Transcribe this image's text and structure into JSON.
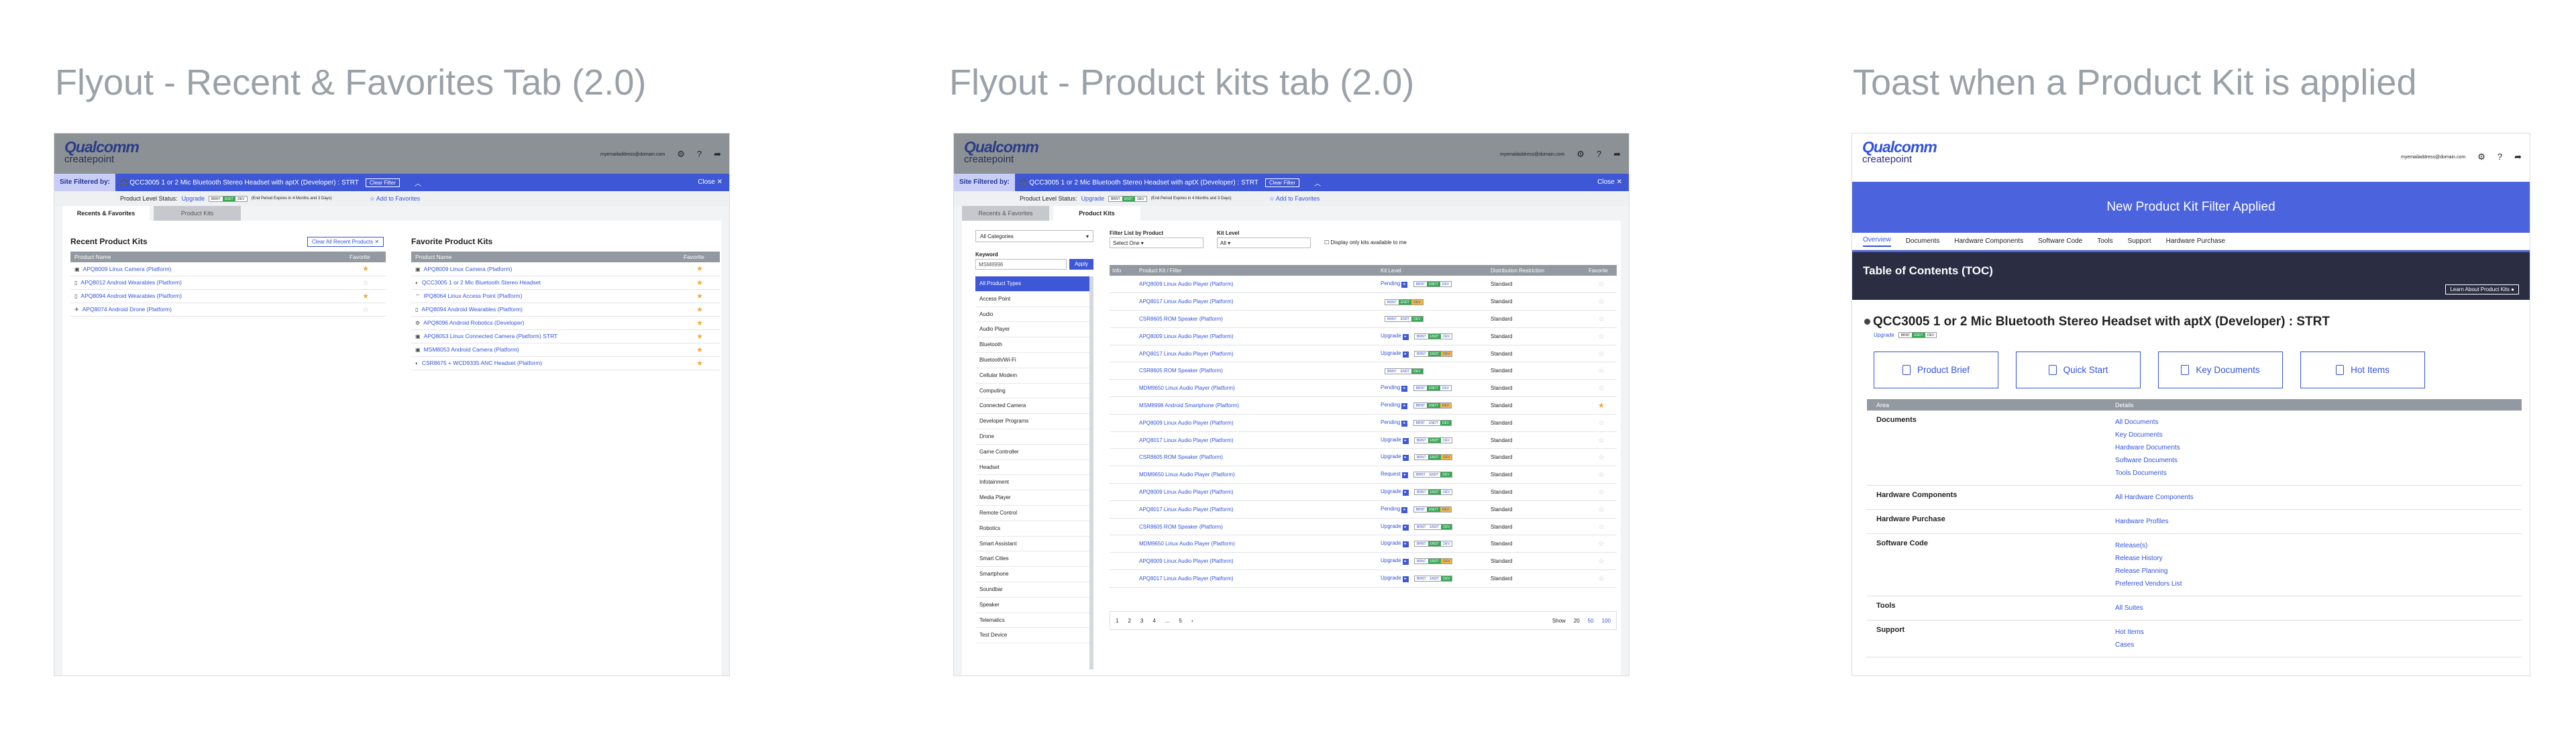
{
  "titles": [
    "Flyout - Recent & Favorites Tab (2.0)",
    "Flyout - Product kits tab (2.0)",
    "Toast when a Product Kit is applied"
  ],
  "header": {
    "logo": "Qualcomm",
    "sub": "createpoint",
    "email": "myemailaddress@domain.com"
  },
  "filter": {
    "label": "Site Filtered by:",
    "product": "QCC3005 1 or 2 Mic Bluetooth Stereo Headset with aptX (Developer) : STRT",
    "clear": "Clear Filter",
    "close": "Close"
  },
  "status": {
    "label": "Product Level Status:",
    "link": "Upgrade",
    "note": "(End Period Expires in 4 Months and 3 Days)",
    "fav": "Add to Favorites",
    "pills": [
      "BRNT",
      "ENDT",
      "DEV"
    ]
  },
  "tabs": [
    "Recents & Favorites",
    "Product Kits"
  ],
  "recent": {
    "title": "Recent Product Kits",
    "clear": "Clear All Recent Products",
    "cols": [
      "Product Name",
      "Favorite"
    ],
    "rows": [
      {
        "name": "APQ8009 Linux Camera (Platform)",
        "fav": true
      },
      {
        "name": "APQ8012 Android Wearables (Platform)",
        "fav": false
      },
      {
        "name": "APQ8094 Android Wearables (Platform)",
        "fav": true
      },
      {
        "name": "APQ8074 Android Drone (Platform)",
        "fav": false
      }
    ]
  },
  "favorite": {
    "title": "Favorite Product Kits",
    "cols": [
      "Product Name",
      "Favorite"
    ],
    "rows": [
      "APQ8009 Linux Camera (Platform)",
      "QCC3005 1 or 2 Mic Bluetooth Stereo Headset",
      "IPQ8064 Linux Access Point (Platform)",
      "APQ8094 Android Wearables (Platform)",
      "APQ8096 Android Robotics (Developer)",
      "APQ8053 Linux Connected Camera (Platform) STRT",
      "MSM8053 Android Camera (Platform)",
      "CSR8675 + WCD9335 ANC Headset (Platform)"
    ]
  },
  "kits": {
    "cat": "All Categories",
    "kwl": "Keyword",
    "kw": "MSM8996",
    "apply": "Apply",
    "types": [
      "All Product Types",
      "Access Point",
      "Audio",
      "Audio Player",
      "Bluetooth",
      "Bluetooth/Wi-Fi",
      "Cellular Modem",
      "Computing",
      "Connected Camera",
      "Developer Programs",
      "Drone",
      "Game Controller",
      "Headset",
      "Infotainment",
      "Media Player",
      "Remote Control",
      "Robotics",
      "Smart Assistant",
      "Smart Cities",
      "Smartphone",
      "Soundbar",
      "Speaker",
      "Telematics",
      "Test Device"
    ],
    "f1": "Filter List by Product",
    "f1v": "Select One",
    "f2": "Kit Level",
    "f2v": "All",
    "chk": "Display only kits available to me",
    "cols": [
      "Info",
      "Product Kit / Filter",
      "Kit Level",
      "Distribution Restriction",
      "Favorite"
    ],
    "rows": [
      {
        "n": "APQ8009 Linux Audio Player (Platform)",
        "k": "Pending",
        "d": "Standard"
      },
      {
        "n": "APQ8017 Linux Audio Player (Platform)",
        "k": "",
        "d": "Standard"
      },
      {
        "n": "CSR8605 ROM Speaker (Platform)",
        "k": "",
        "d": "Standard"
      },
      {
        "n": "APQ8009 Linux Audio Player (Platform)",
        "k": "Upgrade",
        "d": "Standard"
      },
      {
        "n": "APQ8017 Linux Audio Player (Platform)",
        "k": "Upgrade",
        "d": "Standard"
      },
      {
        "n": "CSR8605 ROM Speaker (Platform)",
        "k": "",
        "d": "Standard"
      },
      {
        "n": "MDM9650 Linux Audio Player (Platform)",
        "k": "Pending",
        "d": "Standard"
      },
      {
        "n": "MSM8998 Android Smartphone (Platform)",
        "k": "Pending",
        "d": "Standard"
      },
      {
        "n": "APQ8009 Linux Audio Player (Platform)",
        "k": "Pending",
        "d": "Standard"
      },
      {
        "n": "APQ8017 Linux Audio Player (Platform)",
        "k": "Upgrade",
        "d": "Standard"
      },
      {
        "n": "CSR8605 ROM Speaker (Platform)",
        "k": "Upgrade",
        "d": "Standard"
      },
      {
        "n": "MDM9650 Linux Audio Player (Platform)",
        "k": "Request",
        "d": "Standard"
      },
      {
        "n": "APQ8009 Linux Audio Player (Platform)",
        "k": "Upgrade",
        "d": "Standard"
      },
      {
        "n": "APQ8017 Linux Audio Player (Platform)",
        "k": "Pending",
        "d": "Standard"
      },
      {
        "n": "CSR8605 ROM Speaker (Platform)",
        "k": "Upgrade",
        "d": "Standard"
      },
      {
        "n": "MDM9650 Linux Audio Player (Platform)",
        "k": "Upgrade",
        "d": "Standard"
      },
      {
        "n": "APQ8009 Linux Audio Player (Platform)",
        "k": "Upgrade",
        "d": "Standard"
      },
      {
        "n": "APQ8017 Linux Audio Player (Platform)",
        "k": "Upgrade",
        "d": "Standard"
      }
    ],
    "pages": [
      "1",
      "2",
      "3",
      "4",
      "...",
      "5"
    ],
    "show": "Show",
    "sizes": [
      "20",
      "50",
      "100"
    ]
  },
  "toast": {
    "msg": "New Product Kit Filter Applied",
    "nav": [
      "Overview",
      "Documents",
      "Hardware Components",
      "Software Code",
      "Tools",
      "Support",
      "Hardware Purchase"
    ],
    "toc": "Table of Contents (TOC)",
    "learn": "Learn About Product Kits",
    "pname": "QCC3005 1 or 2 Mic Bluetooth Stereo Headset with aptX (Developer) : STRT",
    "upg": "Upgrade",
    "cards": [
      "Product Brief",
      "Quick Start",
      "Key Documents",
      "Hot Items"
    ],
    "cols": [
      "Area",
      "Details"
    ],
    "areas": [
      {
        "k": "Documents",
        "v": [
          "All Documents",
          "Key Documents",
          "Hardware Documents",
          "Software Documents",
          "Tools Documents"
        ]
      },
      {
        "k": "Hardware Components",
        "v": [
          "All Hardware Components"
        ]
      },
      {
        "k": "Hardware Purchase",
        "v": [
          "Hardware Profiles"
        ]
      },
      {
        "k": "Software Code",
        "v": [
          "Release(s)",
          "Release History",
          "Release Planning",
          "Preferred Vendors List"
        ]
      },
      {
        "k": "Tools",
        "v": [
          "All Suites"
        ]
      },
      {
        "k": "Support",
        "v": [
          "Hot Items",
          "Cases"
        ]
      }
    ]
  }
}
